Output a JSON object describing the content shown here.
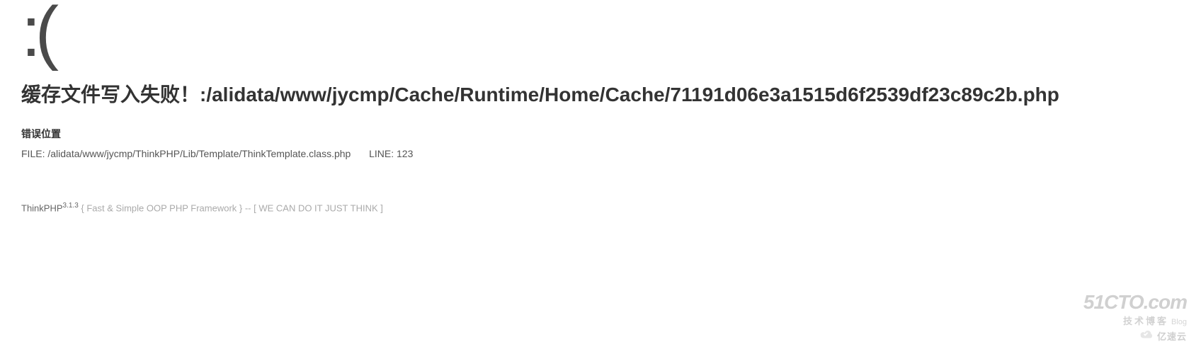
{
  "sadFace": ":(",
  "error": {
    "title": "缓存文件写入失败！:/alidata/www/jycmp/Cache/Runtime/Home/Cache/71191d06e3a1515d6f2539df23c89c2b.php",
    "locationHeading": "错误位置",
    "fileLabel": "FILE:",
    "filePath": "/alidata/www/jycmp/ThinkPHP/Lib/Template/ThinkTemplate.class.php",
    "lineLabel": "LINE:",
    "lineNumber": "123"
  },
  "footer": {
    "brand": "ThinkPHP",
    "version": "3.1.3",
    "tagline": "{ Fast & Simple OOP PHP Framework } -- [ WE CAN DO IT JUST THINK ]"
  },
  "watermark": {
    "site": "51CTO.com",
    "sub": "技术博客",
    "blog": "Blog",
    "yun": "亿速云"
  }
}
